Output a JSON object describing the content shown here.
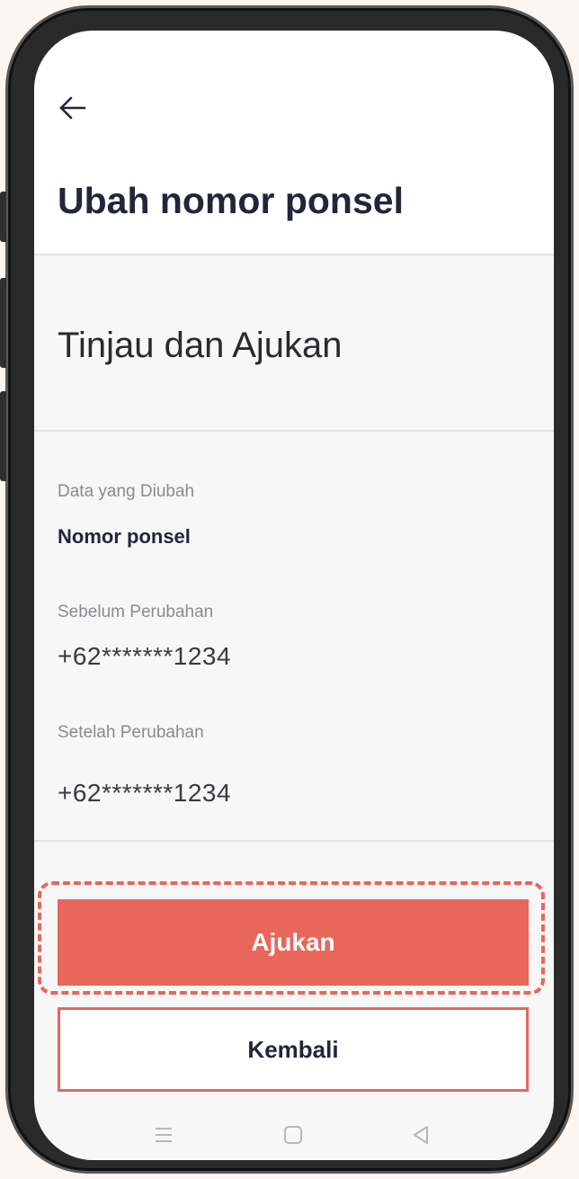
{
  "header": {
    "back_icon": "arrow-left-icon",
    "title": "Ubah nomor ponsel"
  },
  "section": {
    "title": "Tinjau dan Ajukan"
  },
  "fields": {
    "changed_data_label": "Data yang Diubah",
    "changed_data_value": "Nomor ponsel",
    "before_label": "Sebelum Perubahan",
    "before_value": "+62*******1234",
    "after_label": "Setelah Perubahan",
    "after_value": "+62*******1234"
  },
  "actions": {
    "submit_label": "Ajukan",
    "back_label": "Kembali"
  },
  "navbar": {
    "icons": [
      "menu-icon",
      "home-icon",
      "back-triangle-icon"
    ]
  },
  "colors": {
    "accent": "#e8665a",
    "title_text": "#23263a"
  }
}
